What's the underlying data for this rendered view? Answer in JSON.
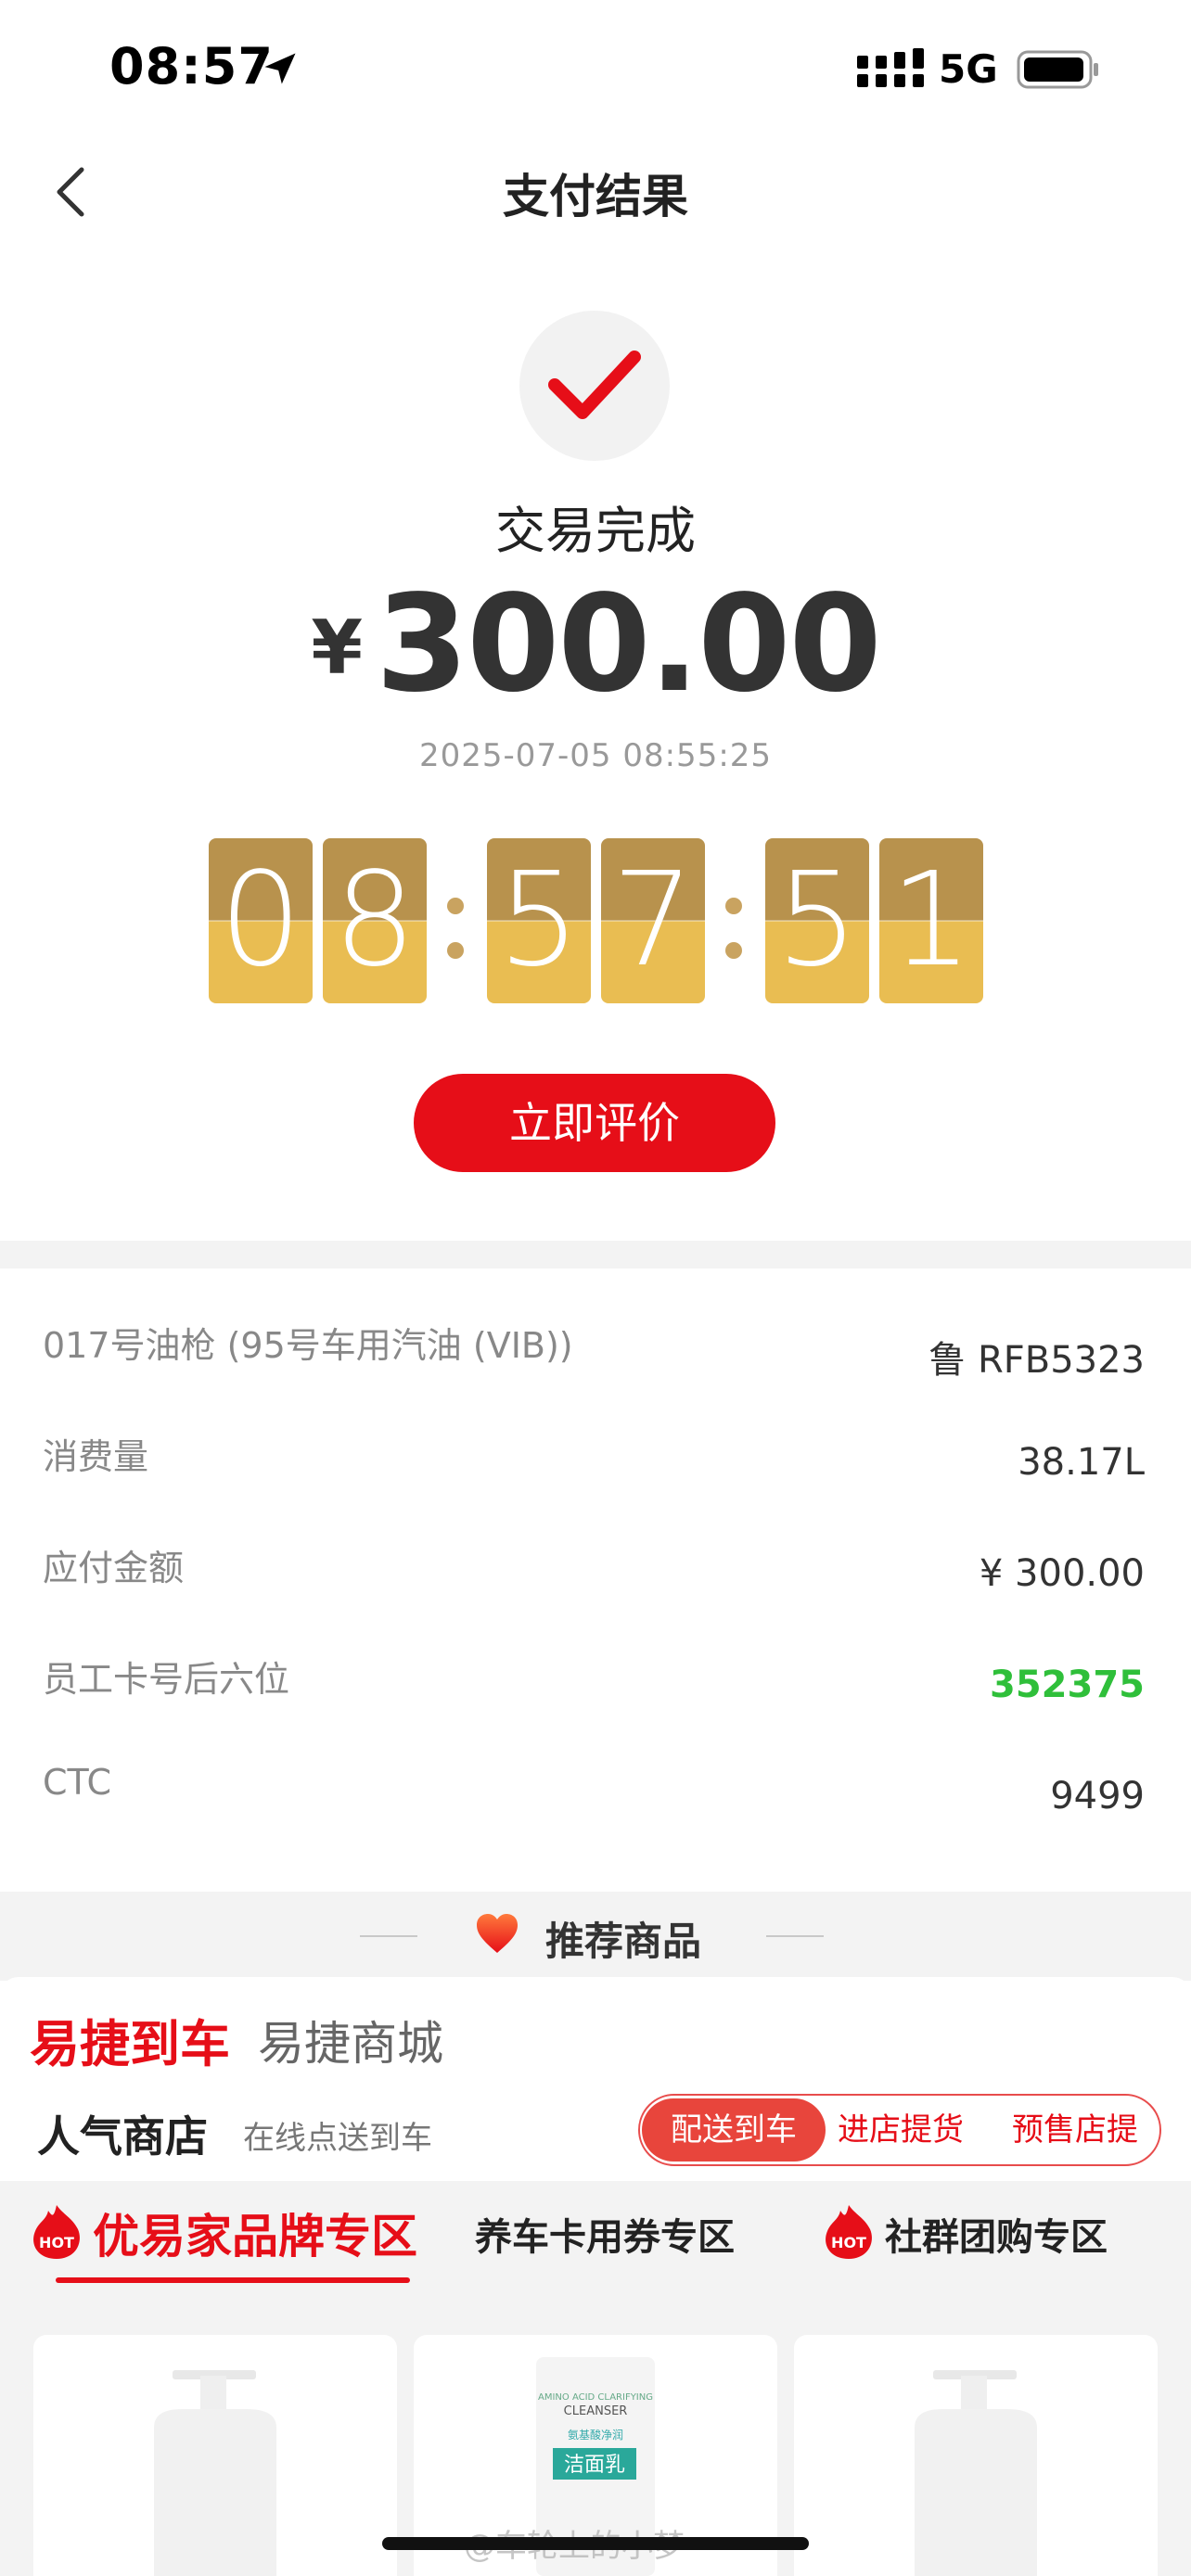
{
  "status_bar": {
    "time": "08:57",
    "network": "5G"
  },
  "nav": {
    "title": "支付结果"
  },
  "result": {
    "status": "交易完成",
    "currency": "¥",
    "amount": "300.00",
    "datetime": "2025-07-05 08:55:25",
    "clock_digits": [
      "0",
      "8",
      "5",
      "7",
      "5",
      "1"
    ],
    "review_button": "立即评价"
  },
  "details": [
    {
      "label": "017号油枪 (95号车用汽油 (VIB))",
      "value": "鲁 RFB5323"
    },
    {
      "label": "消费量",
      "value": "38.17L"
    },
    {
      "label": "应付金额",
      "value": "¥ 300.00"
    },
    {
      "label": "员工卡号后六位",
      "value": "352375"
    },
    {
      "label": "CTC",
      "value": "9499"
    }
  ],
  "recommend": {
    "title": "推荐商品",
    "tabs": [
      "易捷到车",
      "易捷商城"
    ],
    "popular_title": "人气商店",
    "popular_sub": "在线点送到车",
    "segments": [
      "配送到车",
      "进店提货",
      "预售店提"
    ],
    "zones": [
      "优易家品牌专区",
      "养车卡用券专区",
      "社群团购专区"
    ],
    "hot_badge": "HOT",
    "product_texts": {
      "cleanser_small": "AMINO ACID CLARIFYING",
      "cleanser_en": "CLEANSER",
      "cleanser_cn_small": "氨基酸净润",
      "cleanser_cn": "洁面乳"
    }
  },
  "watermark": "@车轮上的小梦",
  "colors": {
    "accent": "#e60e18",
    "highlight_green": "#2fbf3a",
    "clock_top": "#b8924d",
    "clock_bottom": "#e9bd52"
  }
}
